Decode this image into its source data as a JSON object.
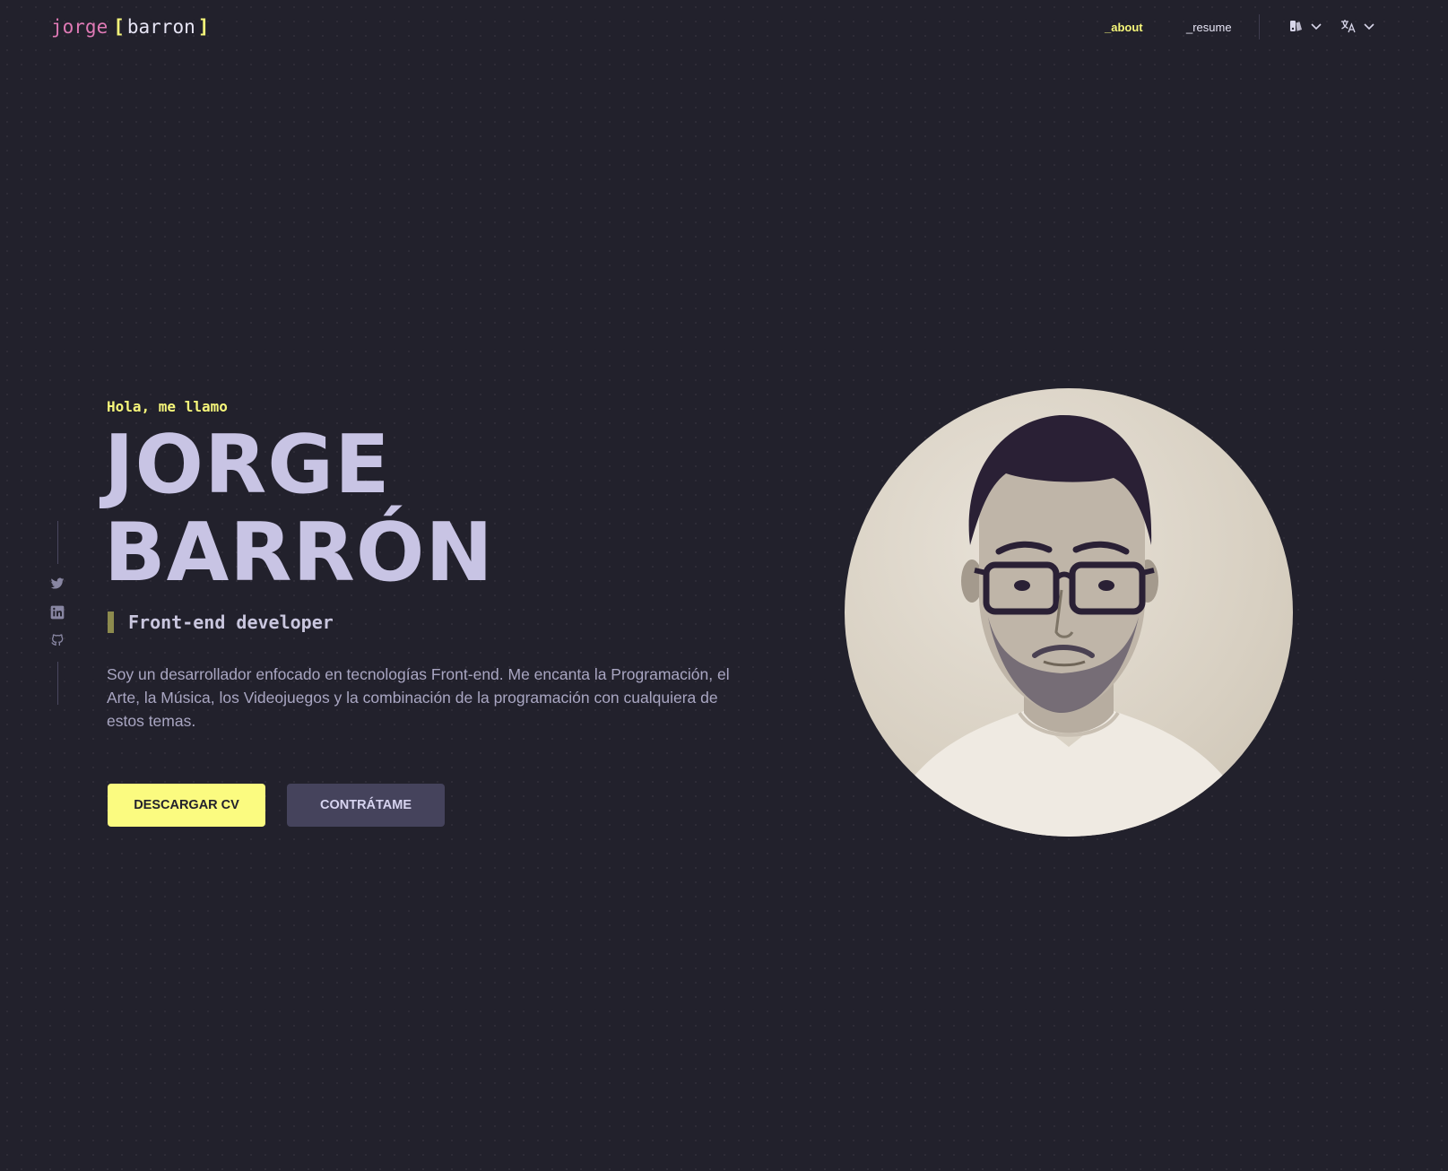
{
  "header": {
    "logo": {
      "first": "jorge",
      "open_bracket": "[",
      "last": "barron",
      "close_bracket": "]"
    },
    "nav": [
      {
        "label": "_about",
        "active": true
      },
      {
        "label": "_resume",
        "active": false
      }
    ],
    "theme_icon": "theme-palette-icon",
    "language_icon": "translate-icon"
  },
  "social": {
    "items": [
      {
        "icon": "twitter-icon"
      },
      {
        "icon": "linkedin-icon"
      },
      {
        "icon": "github-icon"
      }
    ]
  },
  "hero": {
    "greeting": "Hola, me llamo",
    "name_line1": "JORGE",
    "name_line2": "BARRÓN",
    "role": "Front-end developer",
    "bio": "Soy un desarrollador enfocado en tecnologías Front-end. Me encanta la Programación, el Arte, la Música, los Videojuegos y la combinación de la programación con cualquiera de estos temas.",
    "buttons": {
      "download_cv": "DESCARGAR CV",
      "hire_me": "CONTRÁTAME"
    }
  },
  "colors": {
    "background": "#22212c",
    "accent_yellow": "#f6f67a",
    "accent_pink": "#e07ab6",
    "text_primary": "#c8c4e4",
    "button_secondary": "#45435c"
  }
}
